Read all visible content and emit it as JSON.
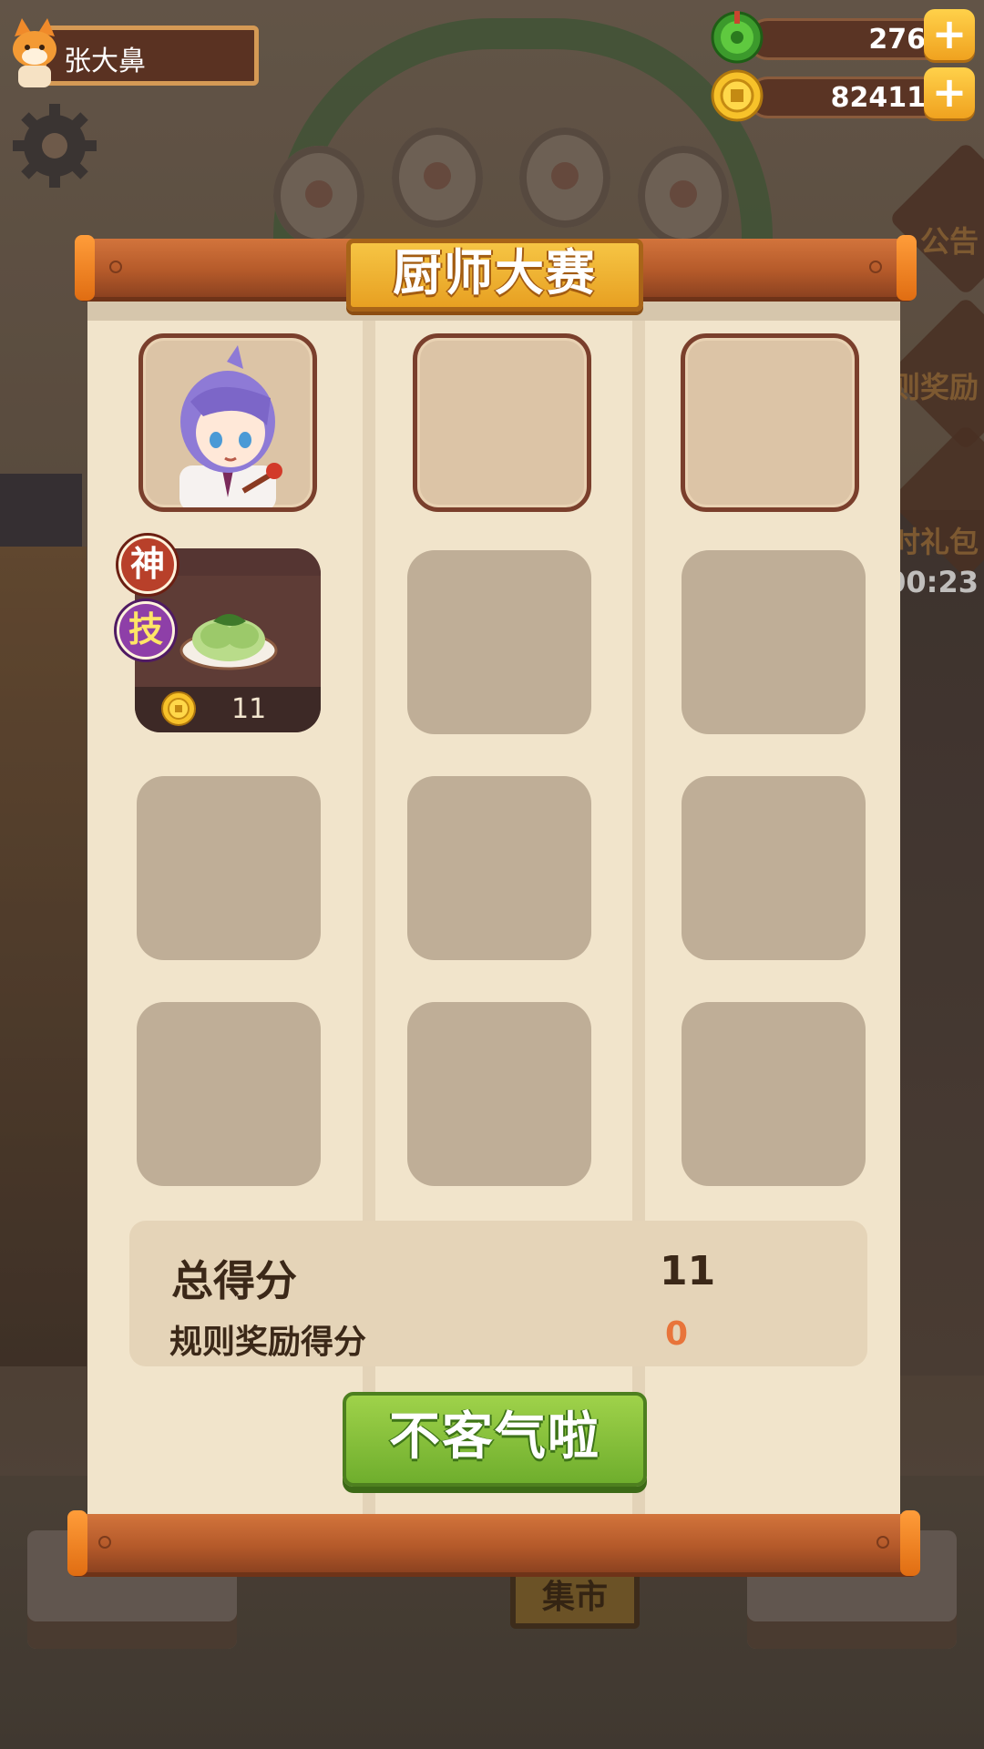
{
  "player": {
    "name": "张大鼻"
  },
  "resources": [
    {
      "icon": "jade-icon",
      "value": "276"
    },
    {
      "icon": "coin-icon",
      "value": "82411"
    }
  ],
  "background": {
    "market_sign": "集市",
    "side_labels": [
      "公告",
      "则奖励",
      "时礼包"
    ],
    "timer": "00:23"
  },
  "dialog": {
    "title": "厨师大赛",
    "chef": {
      "icon": "chef-portrait-purple-hair"
    },
    "dish": {
      "badges": [
        "神",
        "技"
      ],
      "icon": "cabbage-dish-icon",
      "coin_icon": "coin-icon",
      "count": "11"
    },
    "score": {
      "total_label": "总得分",
      "total_value": "11",
      "bonus_label": "规则奖励得分",
      "bonus_value": "0"
    },
    "confirm_button": "不客气啦"
  },
  "colors": {
    "accent_gold": "#f0b030",
    "frame_wood": "#b55a2a",
    "button_green": "#7fbf36",
    "bonus_orange": "#e8743a"
  }
}
